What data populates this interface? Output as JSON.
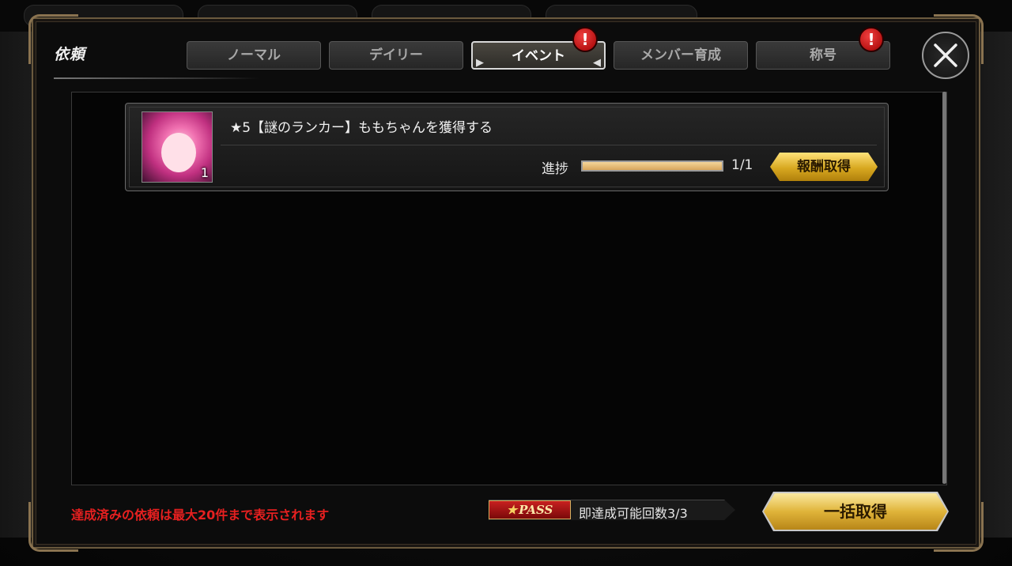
{
  "dialog": {
    "title": "依頼"
  },
  "tabs": [
    {
      "label": "ノーマル",
      "active": false,
      "has_badge": false
    },
    {
      "label": "デイリー",
      "active": false,
      "has_badge": false
    },
    {
      "label": "イベント",
      "active": true,
      "has_badge": true
    },
    {
      "label": "メンバー育成",
      "active": false,
      "has_badge": false
    },
    {
      "label": "称号",
      "active": false,
      "has_badge": true
    }
  ],
  "badge_symbol": "!",
  "quests": [
    {
      "name": "★5【謎のランカー】ももちゃんを獲得する",
      "reward_count": "1",
      "progress_label": "進捗",
      "progress_value": "1/1",
      "progress_fraction": 1.0,
      "claim_label": "報酬取得"
    }
  ],
  "footer": {
    "notice": "達成済みの依頼は最大20件まで表示されます",
    "pass_logo": "PASS",
    "pass_text": "即達成可能回数3/3",
    "bulk_claim_label": "一括取得"
  },
  "colors": {
    "accent_gold": "#d8a820",
    "notice_red": "#e62020",
    "badge_red": "#c00000"
  },
  "icons": {
    "close": "close-icon",
    "badge": "alert-badge-icon",
    "pass": "pass-logo-icon",
    "avatar": "character-portrait"
  }
}
